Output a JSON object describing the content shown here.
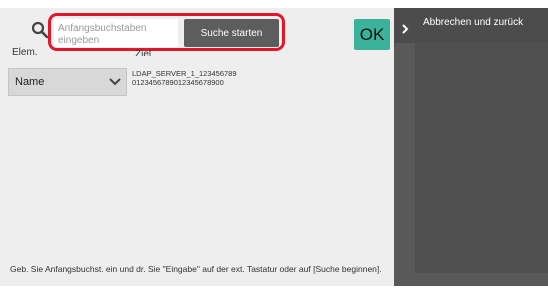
{
  "search": {
    "placeholder": "Anfangsbuchstaben eingeben",
    "start_button": "Suche starten"
  },
  "ok_button": "OK",
  "columns": {
    "item": "Elem.",
    "target": "Ziel"
  },
  "item_select": {
    "selected": "Name"
  },
  "target_value": {
    "line1": "LDAP_SERVER_1_123456789",
    "line2": "0123456789012345678900"
  },
  "hint_text": "Geb. Sie Anfangsbuchst. ein und dr. Sie \"Eingabe\" auf der ext. Tastatur oder auf [Suche beginnen].",
  "sidebar": {
    "cancel_label": "Abbrechen und zurück"
  },
  "colors": {
    "highlight": "#e0182b",
    "ok_button": "#3bb39a",
    "search_button": "#5d5d5d",
    "sidebar": "#595959"
  }
}
